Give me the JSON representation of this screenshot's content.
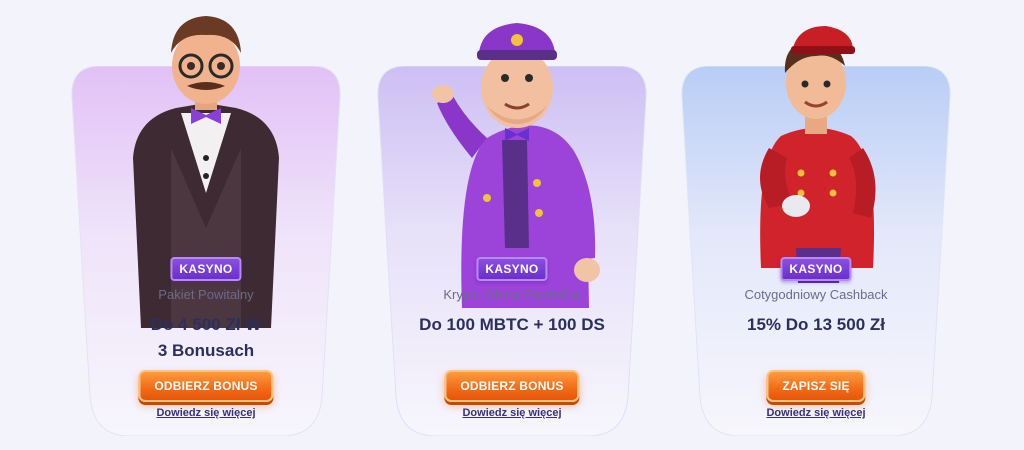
{
  "cards": [
    {
      "badge": "KASYNO",
      "subtitle": "Pakiet Powitalny",
      "offer_line1": "Do 4 500 Zł W",
      "offer_line2": "3 Bonusach",
      "button": "ODBIERZ BONUS",
      "link": "Dowiedz się więcej",
      "character": "host-with-glasses-illustration",
      "tint": "#d9b6f3"
    },
    {
      "badge": "KASYNO",
      "subtitle": "Krypto Oferta Powitalna",
      "offer_line1": "Do 100 MBTC + 100 DS",
      "offer_line2": "",
      "button": "ODBIERZ BONUS",
      "link": "Dowiedz się więcej",
      "character": "doorman-purple-uniform-illustration",
      "tint": "#c8baf3"
    },
    {
      "badge": "KASYNO",
      "subtitle": "Cotygodniowy Cashback",
      "offer_line1": "15% Do 13 500 Zł",
      "offer_line2": "",
      "button": "ZAPISZ SIĘ",
      "link": "Dowiedz się więcej",
      "character": "bellhop-red-uniform-illustration",
      "tint": "#b9cdf5"
    }
  ],
  "colors": {
    "background": "#f3f4fb",
    "badge": "#7a3fd8",
    "button": "#f26a16",
    "offer_text": "#2b2f5e"
  }
}
